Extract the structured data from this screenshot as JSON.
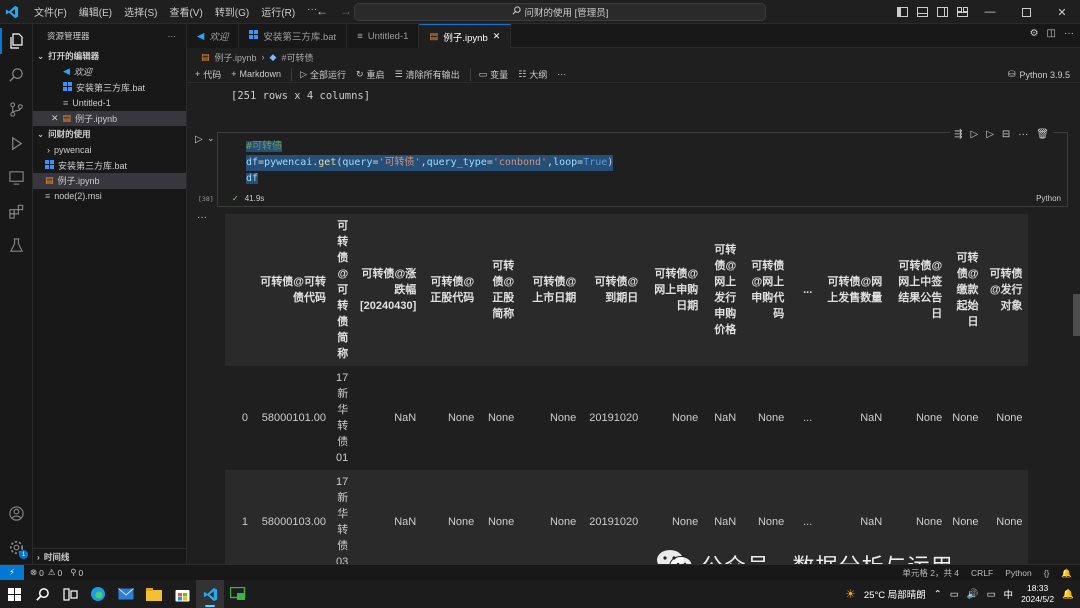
{
  "window": {
    "command_center": "问财的使用 [管理员]"
  },
  "menu": [
    "文件(F)",
    "编辑(E)",
    "选择(S)",
    "查看(V)",
    "转到(G)",
    "运行(R)",
    "···"
  ],
  "sidebar": {
    "title": "资源管理器",
    "open_editors_header": "打开的编辑器",
    "open_editors": [
      "欢迎",
      "安装第三方库.bat",
      "Untitled-1",
      "例子.ipynb"
    ],
    "folder_header": "问财的使用",
    "files": [
      "pywencai",
      "安装第三方库.bat",
      "例子.ipynb",
      "node(2).msi"
    ],
    "timeline_header": "时间线"
  },
  "tabs": [
    "欢迎",
    "安装第三方库.bat",
    "Untitled-1",
    "例子.ipynb"
  ],
  "breadcrumb": {
    "file": "例子.ipynb",
    "section": "#可转债"
  },
  "toolbar": {
    "code": "代码",
    "markdown": "Markdown",
    "run_all": "全部运行",
    "restart": "重启",
    "clear_outputs": "清除所有输出",
    "variables": "变量",
    "outline": "大纲",
    "more": "···",
    "kernel": "Python 3.9.5"
  },
  "previous_output": "[251 rows x 4 columns]",
  "cell": {
    "comment": "#可转债",
    "line2_var": "df",
    "line2_op1": "=",
    "line2_mod": "pywencai",
    "line2_dot": ".",
    "line2_fn": "get",
    "line2_p1": "(",
    "line2_k1": "query",
    "line2_eq1": "=",
    "line2_s1": "'可转债'",
    "line2_c1": ",",
    "line2_k2": "query_type",
    "line2_eq2": "=",
    "line2_s2": "'conbond'",
    "line2_c2": ",",
    "line2_k3": "loop",
    "line2_eq3": "=",
    "line2_v3": "True",
    "line2_p2": ")",
    "line3": "df",
    "exec_count": "[38]",
    "duration": "41.9s",
    "language": "Python"
  },
  "table": {
    "headers": [
      "",
      "可转债@可转债代码",
      "可转债@可转债简称",
      "可转债@涨跌幅[20240430]",
      "可转债@正股代码",
      "可转债@正股简称",
      "可转债@上市日期",
      "可转债@到期日",
      "可转债@网上申购日期",
      "可转债@网上发行申购价格",
      "可转债@网上申购代码",
      "...",
      "可转债@网上发售数量",
      "可转债@网上中签结果公告日",
      "可转债@缴款起始日",
      "可转债@发行对象"
    ],
    "rows": [
      [
        "0",
        "58000101.00",
        "17新华转债01",
        "NaN",
        "None",
        "None",
        "None",
        "20191020",
        "None",
        "NaN",
        "None",
        "...",
        "NaN",
        "None",
        "None",
        "None"
      ],
      [
        "1",
        "58000103.00",
        "17新华转债03",
        "NaN",
        "None",
        "None",
        "None",
        "20191020",
        "None",
        "NaN",
        "None",
        "...",
        "NaN",
        "None",
        "None",
        "None"
      ]
    ]
  },
  "watermark": "公众号 · 数据分析与运用",
  "statusbar": {
    "errors": "0",
    "warnings": "0",
    "ports": "0",
    "right_items": [
      "单元格 2，共 4",
      "CRLF",
      "Python",
      "{}"
    ]
  },
  "taskbar": {
    "weather": "25°C 局部晴朗",
    "ime": "中",
    "time": "18:33",
    "date": "2024/5/2"
  }
}
